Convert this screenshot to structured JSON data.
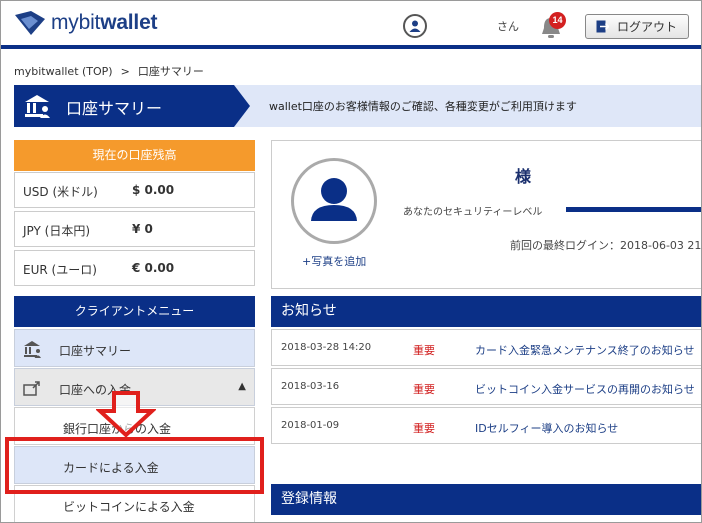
{
  "header": {
    "logo_text_light": "mybit",
    "logo_text_bold": "wallet",
    "user_suffix": "さん",
    "notification_count": "14",
    "logout_label": "ログアウト"
  },
  "breadcrumb": {
    "home": "mybitwallet (TOP)",
    "separator": ">",
    "current": "口座サマリー"
  },
  "titlebar": {
    "title": "口座サマリー",
    "description": "wallet口座のお客様情報のご確認、各種変更がご利用頂けます"
  },
  "balance": {
    "heading": "現在の口座残高",
    "rows": [
      {
        "currency": "USD (米ドル)",
        "amount": "$ 0.00"
      },
      {
        "currency": "JPY (日本円)",
        "amount": "¥ 0"
      },
      {
        "currency": "EUR (ユーロ)",
        "amount": "€ 0.00"
      }
    ]
  },
  "menu": {
    "heading": "クライアントメニュー",
    "items": [
      {
        "label": "口座サマリー"
      },
      {
        "label": "口座への入金"
      }
    ],
    "subitems": [
      {
        "label": "銀行口座からの入金"
      },
      {
        "label": "カードによる入金"
      },
      {
        "label": "ビットコインによる入金"
      }
    ]
  },
  "profile": {
    "name_suffix": "様",
    "security_label": "あなたのセキュリティーレベル",
    "last_login": "前回の最終ログイン：2018-06-03 21",
    "add_photo": "+写真を追加"
  },
  "news": {
    "heading": "お知らせ",
    "rows": [
      {
        "date": "2018-03-28 14:20",
        "tag": "重要",
        "title": "カード入金緊急メンテナンス終了のお知らせ"
      },
      {
        "date": "2018-03-16",
        "tag": "重要",
        "title": "ビットコイン入金サービスの再開のお知らせ"
      },
      {
        "date": "2018-01-09",
        "tag": "重要",
        "title": "IDセルフィー導入のお知らせ"
      }
    ]
  },
  "registration": {
    "heading": "登録情報"
  },
  "colors": {
    "navy": "#0a2f87",
    "orange": "#f59a2c",
    "highlight_red": "#e0201c",
    "menu_active_bg": "#dde6f8"
  },
  "icons": {
    "logo": "mybitwallet-logo-icon",
    "user": "user-icon",
    "bell": "bell-icon",
    "logout": "logout-icon",
    "bank": "bank-icon",
    "deposit": "deposit-icon"
  }
}
